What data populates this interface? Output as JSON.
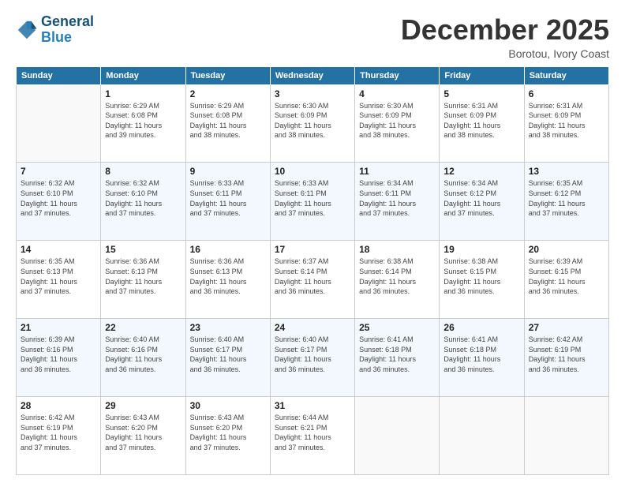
{
  "header": {
    "logo_line1": "General",
    "logo_line2": "Blue",
    "month_title": "December 2025",
    "location": "Borotou, Ivory Coast"
  },
  "weekdays": [
    "Sunday",
    "Monday",
    "Tuesday",
    "Wednesday",
    "Thursday",
    "Friday",
    "Saturday"
  ],
  "weeks": [
    [
      {
        "day": "",
        "info": ""
      },
      {
        "day": "1",
        "info": "Sunrise: 6:29 AM\nSunset: 6:08 PM\nDaylight: 11 hours\nand 39 minutes."
      },
      {
        "day": "2",
        "info": "Sunrise: 6:29 AM\nSunset: 6:08 PM\nDaylight: 11 hours\nand 38 minutes."
      },
      {
        "day": "3",
        "info": "Sunrise: 6:30 AM\nSunset: 6:09 PM\nDaylight: 11 hours\nand 38 minutes."
      },
      {
        "day": "4",
        "info": "Sunrise: 6:30 AM\nSunset: 6:09 PM\nDaylight: 11 hours\nand 38 minutes."
      },
      {
        "day": "5",
        "info": "Sunrise: 6:31 AM\nSunset: 6:09 PM\nDaylight: 11 hours\nand 38 minutes."
      },
      {
        "day": "6",
        "info": "Sunrise: 6:31 AM\nSunset: 6:09 PM\nDaylight: 11 hours\nand 38 minutes."
      }
    ],
    [
      {
        "day": "7",
        "info": "Sunrise: 6:32 AM\nSunset: 6:10 PM\nDaylight: 11 hours\nand 37 minutes."
      },
      {
        "day": "8",
        "info": "Sunrise: 6:32 AM\nSunset: 6:10 PM\nDaylight: 11 hours\nand 37 minutes."
      },
      {
        "day": "9",
        "info": "Sunrise: 6:33 AM\nSunset: 6:11 PM\nDaylight: 11 hours\nand 37 minutes."
      },
      {
        "day": "10",
        "info": "Sunrise: 6:33 AM\nSunset: 6:11 PM\nDaylight: 11 hours\nand 37 minutes."
      },
      {
        "day": "11",
        "info": "Sunrise: 6:34 AM\nSunset: 6:11 PM\nDaylight: 11 hours\nand 37 minutes."
      },
      {
        "day": "12",
        "info": "Sunrise: 6:34 AM\nSunset: 6:12 PM\nDaylight: 11 hours\nand 37 minutes."
      },
      {
        "day": "13",
        "info": "Sunrise: 6:35 AM\nSunset: 6:12 PM\nDaylight: 11 hours\nand 37 minutes."
      }
    ],
    [
      {
        "day": "14",
        "info": "Sunrise: 6:35 AM\nSunset: 6:13 PM\nDaylight: 11 hours\nand 37 minutes."
      },
      {
        "day": "15",
        "info": "Sunrise: 6:36 AM\nSunset: 6:13 PM\nDaylight: 11 hours\nand 37 minutes."
      },
      {
        "day": "16",
        "info": "Sunrise: 6:36 AM\nSunset: 6:13 PM\nDaylight: 11 hours\nand 36 minutes."
      },
      {
        "day": "17",
        "info": "Sunrise: 6:37 AM\nSunset: 6:14 PM\nDaylight: 11 hours\nand 36 minutes."
      },
      {
        "day": "18",
        "info": "Sunrise: 6:38 AM\nSunset: 6:14 PM\nDaylight: 11 hours\nand 36 minutes."
      },
      {
        "day": "19",
        "info": "Sunrise: 6:38 AM\nSunset: 6:15 PM\nDaylight: 11 hours\nand 36 minutes."
      },
      {
        "day": "20",
        "info": "Sunrise: 6:39 AM\nSunset: 6:15 PM\nDaylight: 11 hours\nand 36 minutes."
      }
    ],
    [
      {
        "day": "21",
        "info": "Sunrise: 6:39 AM\nSunset: 6:16 PM\nDaylight: 11 hours\nand 36 minutes."
      },
      {
        "day": "22",
        "info": "Sunrise: 6:40 AM\nSunset: 6:16 PM\nDaylight: 11 hours\nand 36 minutes."
      },
      {
        "day": "23",
        "info": "Sunrise: 6:40 AM\nSunset: 6:17 PM\nDaylight: 11 hours\nand 36 minutes."
      },
      {
        "day": "24",
        "info": "Sunrise: 6:40 AM\nSunset: 6:17 PM\nDaylight: 11 hours\nand 36 minutes."
      },
      {
        "day": "25",
        "info": "Sunrise: 6:41 AM\nSunset: 6:18 PM\nDaylight: 11 hours\nand 36 minutes."
      },
      {
        "day": "26",
        "info": "Sunrise: 6:41 AM\nSunset: 6:18 PM\nDaylight: 11 hours\nand 36 minutes."
      },
      {
        "day": "27",
        "info": "Sunrise: 6:42 AM\nSunset: 6:19 PM\nDaylight: 11 hours\nand 36 minutes."
      }
    ],
    [
      {
        "day": "28",
        "info": "Sunrise: 6:42 AM\nSunset: 6:19 PM\nDaylight: 11 hours\nand 37 minutes."
      },
      {
        "day": "29",
        "info": "Sunrise: 6:43 AM\nSunset: 6:20 PM\nDaylight: 11 hours\nand 37 minutes."
      },
      {
        "day": "30",
        "info": "Sunrise: 6:43 AM\nSunset: 6:20 PM\nDaylight: 11 hours\nand 37 minutes."
      },
      {
        "day": "31",
        "info": "Sunrise: 6:44 AM\nSunset: 6:21 PM\nDaylight: 11 hours\nand 37 minutes."
      },
      {
        "day": "",
        "info": ""
      },
      {
        "day": "",
        "info": ""
      },
      {
        "day": "",
        "info": ""
      }
    ]
  ]
}
